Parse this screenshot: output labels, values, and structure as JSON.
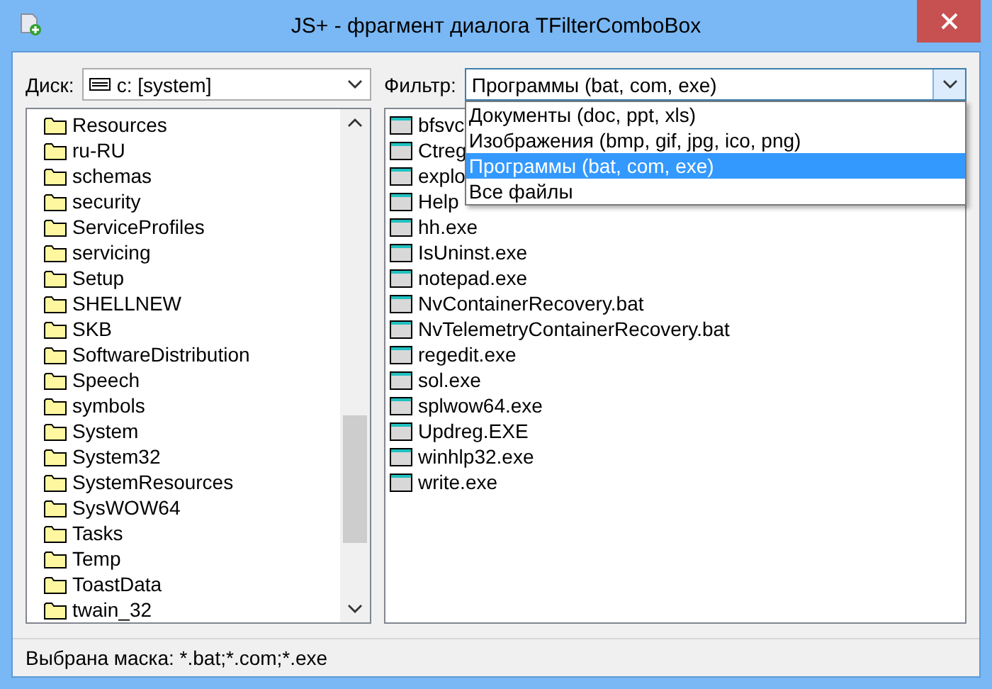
{
  "window": {
    "title": "JS+ - фрагмент диалога TFilterComboBox"
  },
  "drive": {
    "label": "Диск:",
    "value": "c: [system]"
  },
  "filter": {
    "label": "Фильтр:",
    "value": "Программы (bat, com, exe)",
    "expanded": true,
    "options": [
      {
        "label": "Документы (doc, ppt, xls)",
        "selected": false
      },
      {
        "label": "Изображения (bmp, gif, jpg, ico, png)",
        "selected": false
      },
      {
        "label": "Программы (bat, com, exe)",
        "selected": true
      },
      {
        "label": "Все файлы",
        "selected": false
      }
    ]
  },
  "folders": [
    "Resources",
    "ru-RU",
    "schemas",
    "security",
    "ServiceProfiles",
    "servicing",
    "Setup",
    "SHELLNEW",
    "SKB",
    "SoftwareDistribution",
    "Speech",
    "symbols",
    "System",
    "System32",
    "SystemResources",
    "SysWOW64",
    "Tasks",
    "Temp",
    "ToastData",
    "twain_32"
  ],
  "files": [
    "bfsvc",
    "Ctreg",
    "explo",
    "Help",
    "hh.exe",
    "IsUninst.exe",
    "notepad.exe",
    "NvContainerRecovery.bat",
    "NvTelemetryContainerRecovery.bat",
    "regedit.exe",
    "sol.exe",
    "splwow64.exe",
    "Updreg.EXE",
    "winhlp32.exe",
    "write.exe"
  ],
  "status_bar": "Выбрана маска: *.bat;*.com;*.exe"
}
